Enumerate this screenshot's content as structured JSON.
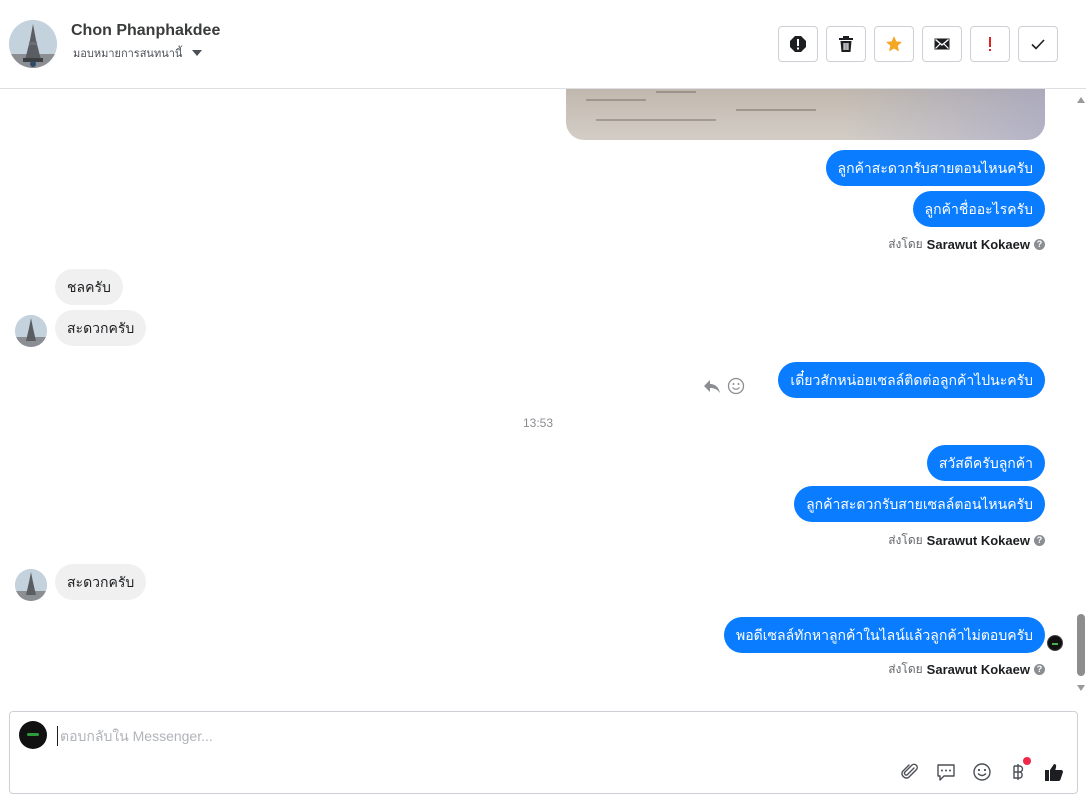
{
  "header": {
    "contact_name": "Chon Phanphakdee",
    "assign_label": "มอบหมายการสนทนานี้",
    "actions": [
      {
        "name": "spam-button",
        "icon": "alert-circle-icon"
      },
      {
        "name": "delete-button",
        "icon": "trash-icon"
      },
      {
        "name": "star-button",
        "icon": "star-icon",
        "color": "#f5a623"
      },
      {
        "name": "mark-unread-button",
        "icon": "envelope-icon"
      },
      {
        "name": "follow-up-button",
        "icon": "exclamation-icon",
        "color": "#e02424"
      },
      {
        "name": "mark-done-button",
        "icon": "checkmark-icon"
      }
    ]
  },
  "messages": {
    "m1": "ลูกค้าสะดวกรับสายตอนไหนครับ",
    "m2": "ลูกค้าชื่ออะไรครับ",
    "sent1_prefix": "ส่งโดย",
    "sent1_name": "Sarawut Kokaew",
    "m3": "ชลครับ",
    "m4": "สะดวกครับ",
    "m5": "เดี๋ยวสักหน่อยเซลล์ติดต่อลูกค้าไปนะครับ",
    "time1": "13:53",
    "m6": "สวัสดีครับลูกค้า",
    "m7": "ลูกค้าสะดวกรับสายเซลล์ตอนไหนครับ",
    "sent2_prefix": "ส่งโดย",
    "sent2_name": "Sarawut Kokaew",
    "m8": "สะดวกครับ",
    "m9": "พอดีเซลล์ทักหาลูกค้าในไลน์แล้วลูกค้าไม่ตอบครับ",
    "sent3_prefix": "ส่งโดย",
    "sent3_name": "Sarawut Kokaew"
  },
  "composer": {
    "placeholder": "ตอบกลับใน Messenger...",
    "tools": [
      "paperclip-icon",
      "saved-reply-icon",
      "emoji-icon",
      "baht-payment-icon",
      "like-icon"
    ]
  },
  "colors": {
    "outgoing_bubble": "#0a7cff",
    "incoming_bubble": "#f0f0f0"
  }
}
